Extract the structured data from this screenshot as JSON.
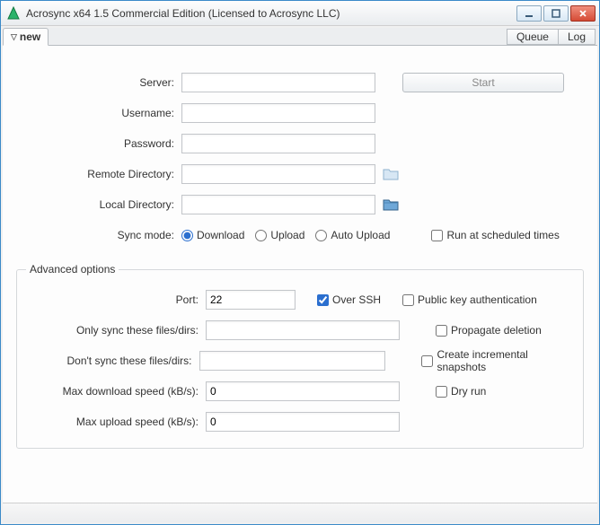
{
  "titlebar": {
    "title": "Acrosync x64 1.5 Commercial Edition (Licensed to Acrosync LLC)"
  },
  "tabs": {
    "active": "new",
    "queue": "Queue",
    "log": "Log"
  },
  "main": {
    "server_label": "Server:",
    "server_value": "",
    "start_label": "Start",
    "username_label": "Username:",
    "username_value": "",
    "password_label": "Password:",
    "password_value": "",
    "remote_dir_label": "Remote Directory:",
    "remote_dir_value": "",
    "local_dir_label": "Local Directory:",
    "local_dir_value": "",
    "sync_mode_label": "Sync mode:",
    "download_label": "Download",
    "upload_label": "Upload",
    "auto_upload_label": "Auto Upload",
    "scheduled_label": "Run at scheduled times"
  },
  "adv": {
    "legend": "Advanced options",
    "port_label": "Port:",
    "port_value": "22",
    "over_ssh_label": "Over SSH",
    "pubkey_label": "Public key authentication",
    "only_sync_label": "Only sync these files/dirs:",
    "only_sync_value": "",
    "propagate_label": "Propagate deletion",
    "dont_sync_label": "Don't sync these files/dirs:",
    "dont_sync_value": "",
    "snapshots_label": "Create incremental snapshots",
    "max_dl_label": "Max download speed (kB/s):",
    "max_dl_value": "0",
    "dry_run_label": "Dry run",
    "max_ul_label": "Max upload speed (kB/s):",
    "max_ul_value": "0"
  }
}
